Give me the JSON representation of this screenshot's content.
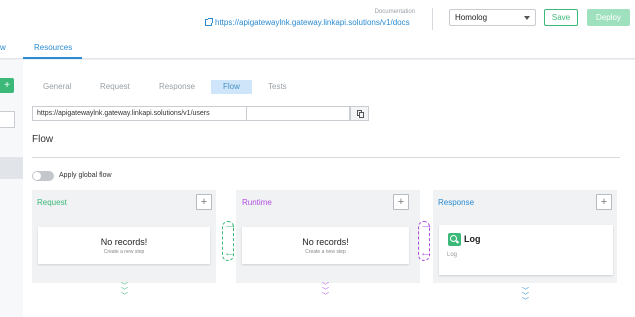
{
  "header": {
    "doc_caption": "Documentation",
    "doc_link": "https://apigatewaylnk.gateway.linkapi.solutions/v1/docs",
    "environment": "Homolog",
    "save_label": "Save",
    "deploy_label": "Deploy"
  },
  "tabs": {
    "partial_left": "w",
    "resources": "Resources"
  },
  "left": {
    "plus": "+"
  },
  "subtabs": [
    "General",
    "Request",
    "Response",
    "Flow",
    "Tests"
  ],
  "url": {
    "value": "https://apigatewaylnk.gateway.linkapi.solutions/v1/users"
  },
  "flow": {
    "title": "Flow",
    "global_flow_label": "Apply global flow",
    "columns": [
      {
        "title": "Request",
        "color": "#3cb879",
        "empty_title": "No records!",
        "empty_sub": "Create a new step"
      },
      {
        "title": "Runtime",
        "color": "#b14ee0",
        "empty_title": "No records!",
        "empty_sub": "Create a new step"
      },
      {
        "title": "Response",
        "color": "#2a8bd0",
        "step_title": "Log",
        "step_sub": "Log"
      }
    ],
    "add_button": "+"
  },
  "colors": {
    "accent_green": "#3cb879",
    "accent_blue": "#2a8bd0",
    "accent_purple": "#b14ee0"
  }
}
